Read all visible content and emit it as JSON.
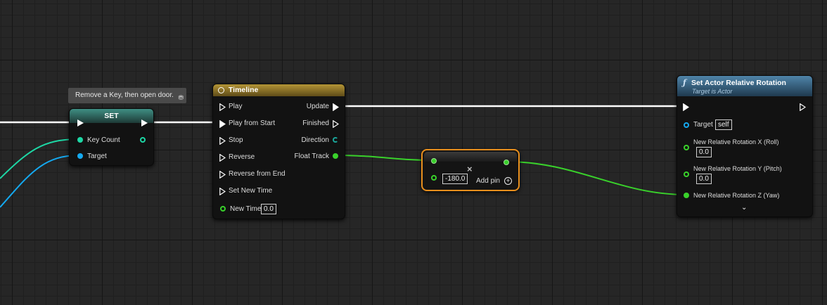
{
  "comment": {
    "text": "Remove a Key, then open door."
  },
  "set_node": {
    "title": "SET",
    "pins": {
      "key_count": "Key Count",
      "target": "Target"
    }
  },
  "timeline_node": {
    "title": "Timeline",
    "inputs": {
      "play": "Play",
      "play_from_start": "Play from Start",
      "stop": "Stop",
      "reverse": "Reverse",
      "reverse_from_end": "Reverse from End",
      "set_new_time": "Set New Time",
      "new_time": "New Time"
    },
    "new_time_value": "0.0",
    "outputs": {
      "update": "Update",
      "finished": "Finished",
      "direction": "Direction",
      "float_track": "Float Track"
    }
  },
  "multiply_node": {
    "value": "-180.0",
    "add_pin": "Add pin"
  },
  "rotation_node": {
    "title": "Set Actor Relative Rotation",
    "subtitle": "Target is Actor",
    "target_label": "Target",
    "target_value": "self",
    "x_label": "New Relative Rotation X (Roll)",
    "x_value": "0.0",
    "y_label": "New Relative Rotation Y (Pitch)",
    "y_value": "0.0",
    "z_label": "New Relative Rotation Z (Yaw)"
  },
  "colors": {
    "exec_wire": "#ffffff",
    "int_pin": "#1dd7a5",
    "object_pin": "#14a9f0",
    "float_pin": "#39d12b",
    "timeline_header": "#8f7526",
    "function_header": "#3e6b8a",
    "selection_outline": "#e88f1d"
  }
}
